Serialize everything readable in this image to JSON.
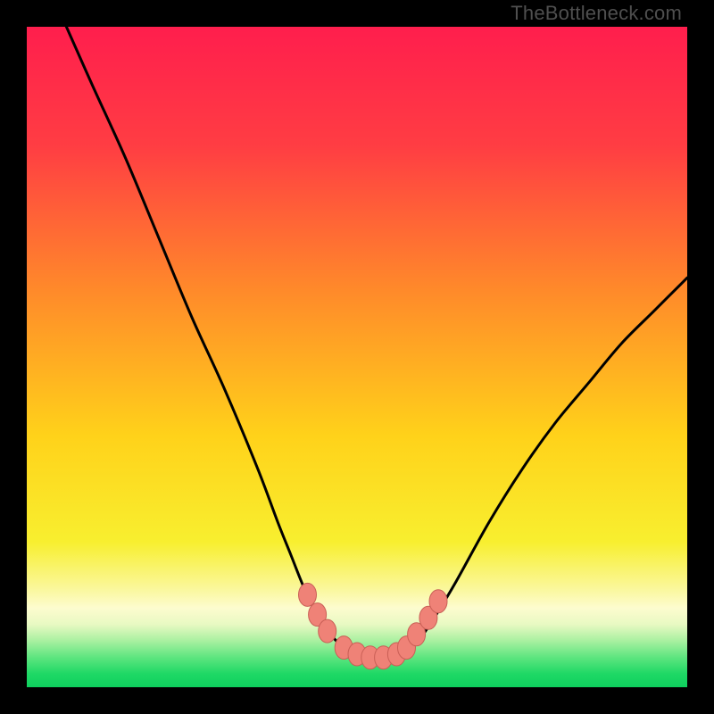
{
  "watermark": "TheBottleneck.com",
  "colors": {
    "frame": "#000000",
    "curve": "#000000",
    "marker_fill": "#ef8277",
    "marker_stroke": "#c95f56",
    "gradient_stops": [
      {
        "offset": 0.0,
        "color": "#ff1e4d"
      },
      {
        "offset": 0.18,
        "color": "#ff3d43"
      },
      {
        "offset": 0.4,
        "color": "#ff8a2a"
      },
      {
        "offset": 0.62,
        "color": "#ffd21a"
      },
      {
        "offset": 0.78,
        "color": "#f8ef2f"
      },
      {
        "offset": 0.85,
        "color": "#faf79a"
      },
      {
        "offset": 0.88,
        "color": "#fdfccf"
      },
      {
        "offset": 0.905,
        "color": "#e8f9c2"
      },
      {
        "offset": 0.93,
        "color": "#a8f0a0"
      },
      {
        "offset": 0.955,
        "color": "#5de57f"
      },
      {
        "offset": 0.98,
        "color": "#1ed865"
      },
      {
        "offset": 1.0,
        "color": "#0fd05e"
      }
    ]
  },
  "chart_data": {
    "type": "line",
    "title": "",
    "xlabel": "",
    "ylabel": "",
    "xlim": [
      0,
      100
    ],
    "ylim": [
      0,
      100
    ],
    "series": [
      {
        "name": "bottleneck-curve",
        "x": [
          6,
          10,
          15,
          20,
          25,
          30,
          35,
          38,
          40,
          42,
          44,
          46,
          48,
          50,
          52,
          54,
          56,
          58,
          60,
          62,
          65,
          70,
          75,
          80,
          85,
          90,
          95,
          100
        ],
        "y": [
          100,
          91,
          80,
          68,
          56,
          45,
          33,
          25,
          20,
          15,
          11,
          8,
          6,
          5,
          4.5,
          4.5,
          5,
          6,
          8,
          11,
          16,
          25,
          33,
          40,
          46,
          52,
          57,
          62
        ]
      }
    ],
    "markers": {
      "name": "highlight-points",
      "x": [
        42.5,
        44,
        45.5,
        48,
        50,
        52,
        54,
        56,
        57.5,
        59,
        60.8,
        62.3
      ],
      "y": [
        14,
        11,
        8.5,
        6,
        5,
        4.5,
        4.5,
        5,
        6,
        8,
        10.5,
        13
      ]
    }
  }
}
